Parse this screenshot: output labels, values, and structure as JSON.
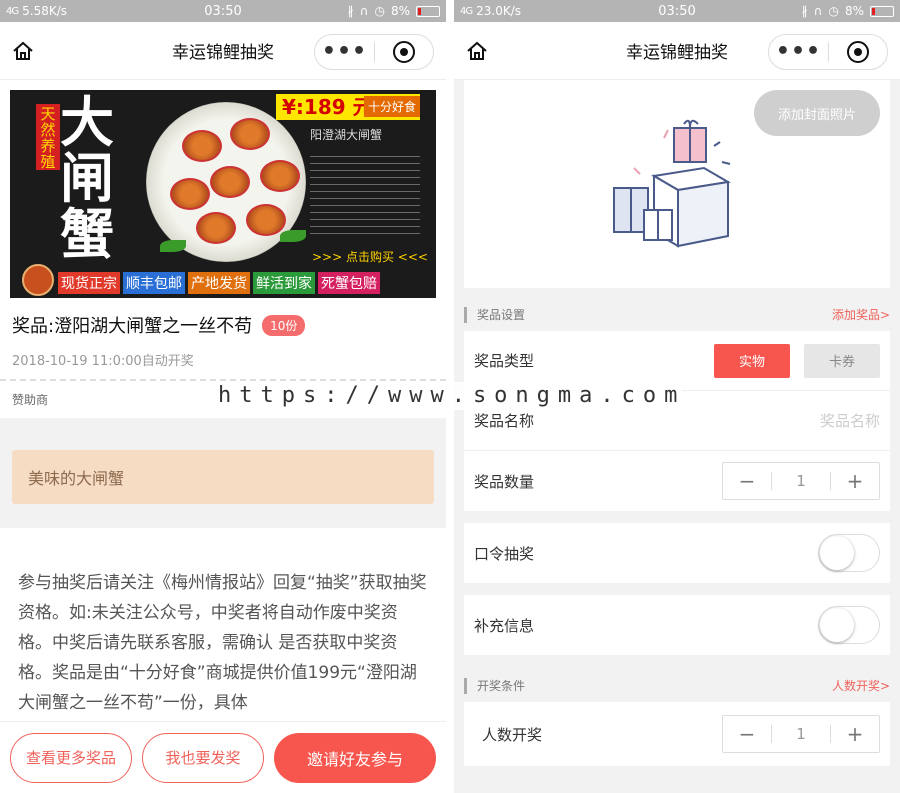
{
  "left": {
    "status": {
      "net": "4G",
      "speed": "5.58K/s",
      "time": "03:50",
      "battery": "8%"
    },
    "nav": {
      "title": "幸运锦鲤抽奖",
      "more": "•••"
    },
    "banner": {
      "badge": "天然养殖",
      "big": "大闸蟹",
      "price": "¥:189 元/8只",
      "price_note": "十分好食",
      "subtitle": "阳澄湖大闸蟹",
      "buy": ">>> 点击购买 <<<",
      "tags": [
        "现货正宗",
        "顺丰包邮",
        "产地发货",
        "鲜活到家",
        "死蟹包赔"
      ]
    },
    "prize": {
      "name": "奖品:澄阳湖大闸蟹之一丝不苟",
      "count": "10份"
    },
    "draw_time": "2018-10-19 11:0:00自动开奖",
    "sponsor_label": "赞助商",
    "sponsor_name": "美味的大闸蟹",
    "description": "参与抽奖后请关注《梅州情报站》回复“抽奖”获取抽奖资格。如:未关注公众号，中奖者将自动作废中奖资格。中奖后请先联系客服，需确认 是否获取中奖资格。奖品是由“十分好食”商城提供价值199元“澄阳湖大闸蟹之一丝不苟”一份，具体",
    "buttons": {
      "more_prizes": "查看更多奖品",
      "publish": "我也要发奖",
      "invite": "邀请好友参与"
    }
  },
  "right": {
    "status": {
      "net": "4G",
      "speed": "23.0K/s",
      "time": "03:50",
      "battery": "8%"
    },
    "nav": {
      "title": "幸运锦鲤抽奖",
      "more": "•••"
    },
    "add_cover": "添加封面照片",
    "prize_section": {
      "title": "奖品设置",
      "link": "添加奖品>"
    },
    "prize_type": {
      "label": "奖品类型",
      "options": [
        "实物",
        "卡券"
      ],
      "selected": "实物"
    },
    "prize_name": {
      "label": "奖品名称",
      "placeholder": "奖品名称"
    },
    "prize_qty": {
      "label": "奖品数量",
      "value": "1",
      "minus": "−",
      "plus": "+"
    },
    "password_draw": {
      "label": "口令抽奖",
      "on": false
    },
    "extra_info": {
      "label": "补充信息",
      "on": false
    },
    "draw_section": {
      "title": "开奖条件",
      "link": "人数开奖>"
    },
    "people_draw": {
      "label": "人数开奖",
      "value": "1",
      "minus": "−",
      "plus": "+"
    }
  },
  "watermark": "https://www.songma.com",
  "colors": {
    "accent": "#f7564e",
    "sponsor_bg": "#f7dcc4",
    "status_bar": "#b4b4b4"
  }
}
